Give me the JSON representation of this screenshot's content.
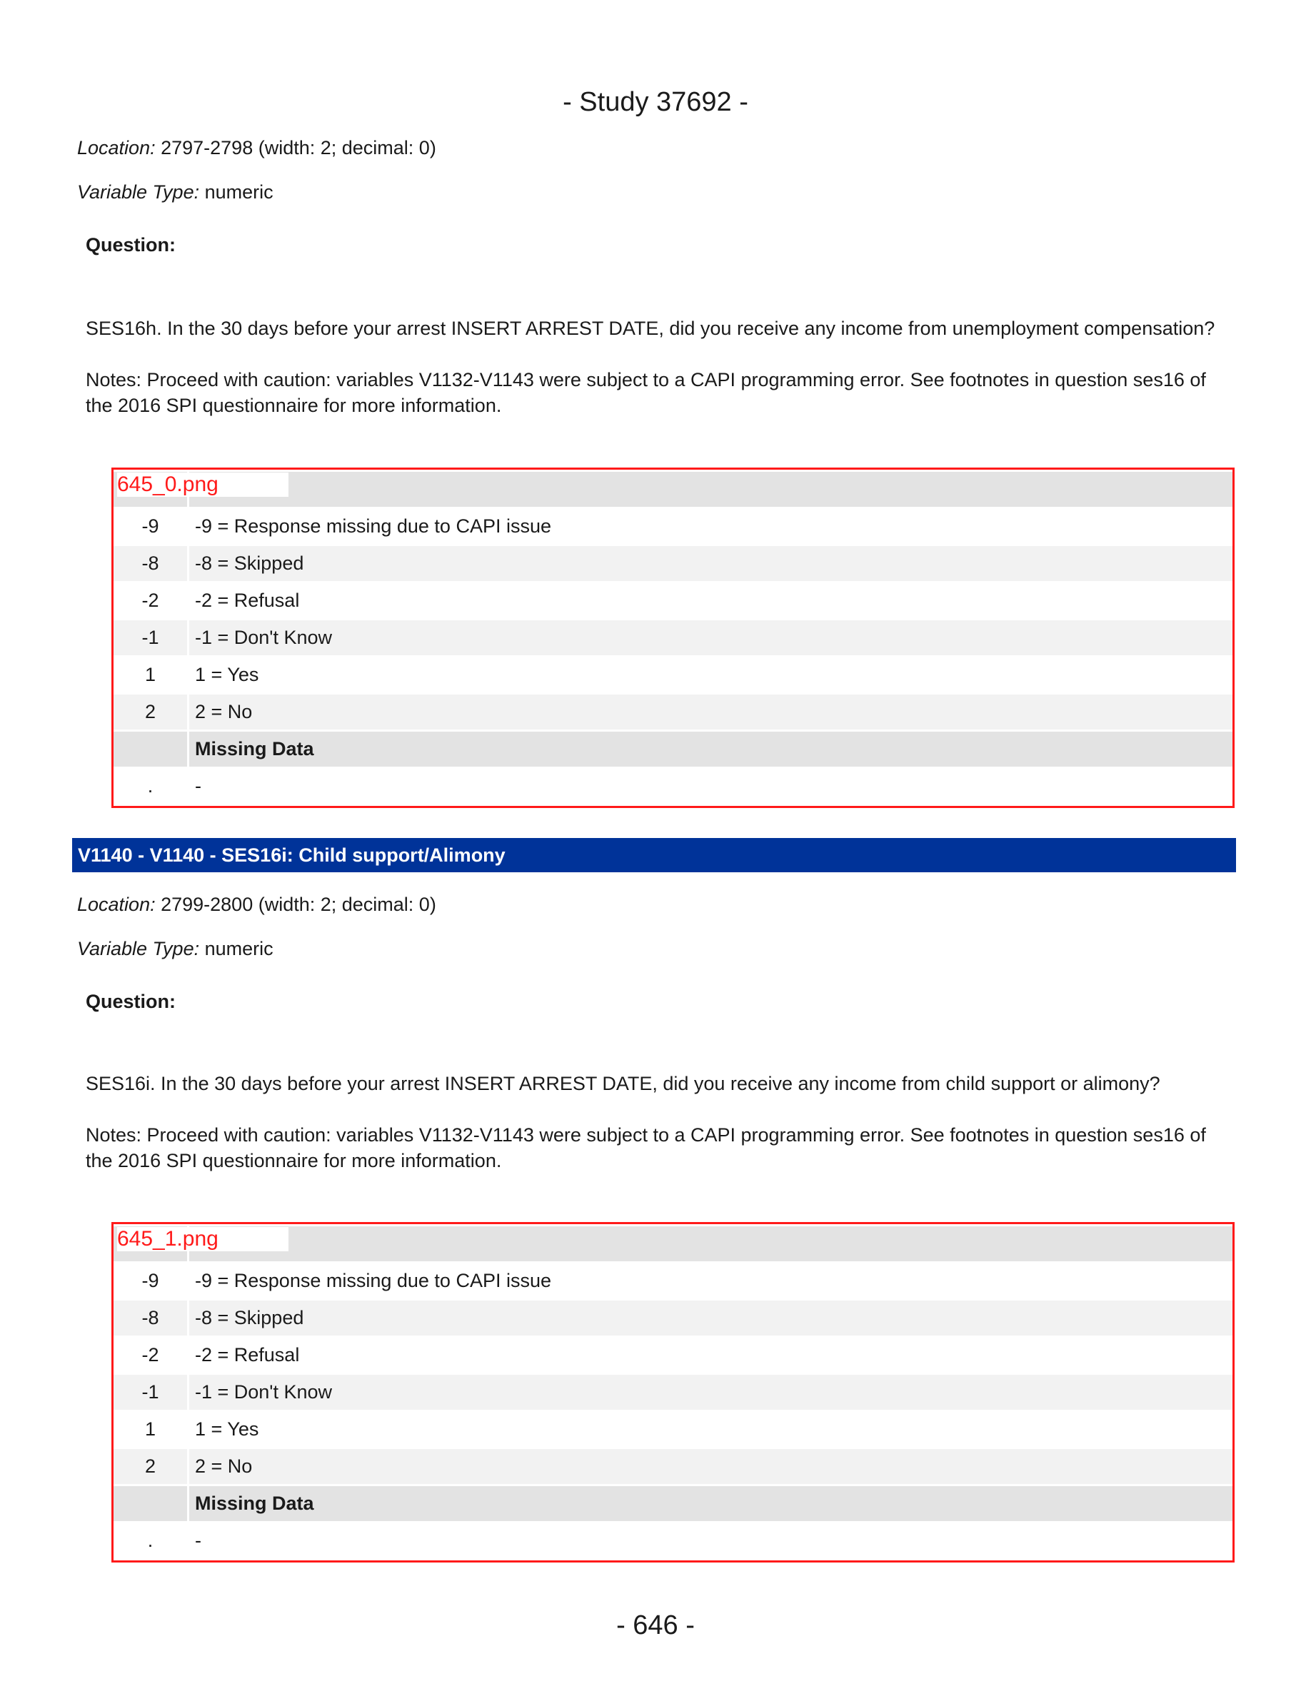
{
  "page": {
    "header": "- Study 37692 -",
    "footer": "- 646 -"
  },
  "blocks": [
    {
      "variable_header": "",
      "location_label": "Location:",
      "location_value": " 2797-2798 (width: 2; decimal: 0)",
      "type_label": "Variable Type:",
      "type_value": " numeric",
      "question_label": "Question:",
      "question_text": "SES16h. In the 30 days before your arrest INSERT ARREST DATE, did you receive any income from unemployment compensation?",
      "notes_text": "Notes: Proceed with caution: variables V1132-V1143 were subject to a CAPI programming error. See footnotes in question ses16 of the 2016 SPI questionnaire for more information.",
      "image_tag": "645_0.png",
      "rows": [
        {
          "code": "-9",
          "label": "-9 = Response missing due to CAPI issue"
        },
        {
          "code": "-8",
          "label": "-8 = Skipped"
        },
        {
          "code": "-2",
          "label": "-2 = Refusal"
        },
        {
          "code": "-1",
          "label": "-1 = Don't Know"
        },
        {
          "code": "1",
          "label": "1 = Yes"
        },
        {
          "code": "2",
          "label": "2 = No"
        }
      ],
      "missing_header": "Missing Data",
      "missing_rows": [
        {
          "code": ".",
          "label": "-"
        }
      ]
    },
    {
      "variable_header": "V1140 - V1140 - SES16i: Child support/Alimony",
      "location_label": "Location:",
      "location_value": " 2799-2800 (width: 2; decimal: 0)",
      "type_label": "Variable Type:",
      "type_value": " numeric",
      "question_label": "Question:",
      "question_text": "SES16i. In the 30 days before your arrest INSERT ARREST DATE, did you receive any income from child support or alimony?",
      "notes_text": "Notes: Proceed with caution: variables V1132-V1143 were subject to a CAPI programming error. See footnotes in question ses16 of the 2016 SPI questionnaire for more information.",
      "image_tag": "645_1.png",
      "rows": [
        {
          "code": "-9",
          "label": "-9 = Response missing due to CAPI issue"
        },
        {
          "code": "-8",
          "label": "-8 = Skipped"
        },
        {
          "code": "-2",
          "label": "-2 = Refusal"
        },
        {
          "code": "-1",
          "label": "-1 = Don't Know"
        },
        {
          "code": "1",
          "label": "1 = Yes"
        },
        {
          "code": "2",
          "label": "2 = No"
        }
      ],
      "missing_header": "Missing Data",
      "missing_rows": [
        {
          "code": ".",
          "label": "-"
        }
      ]
    }
  ]
}
